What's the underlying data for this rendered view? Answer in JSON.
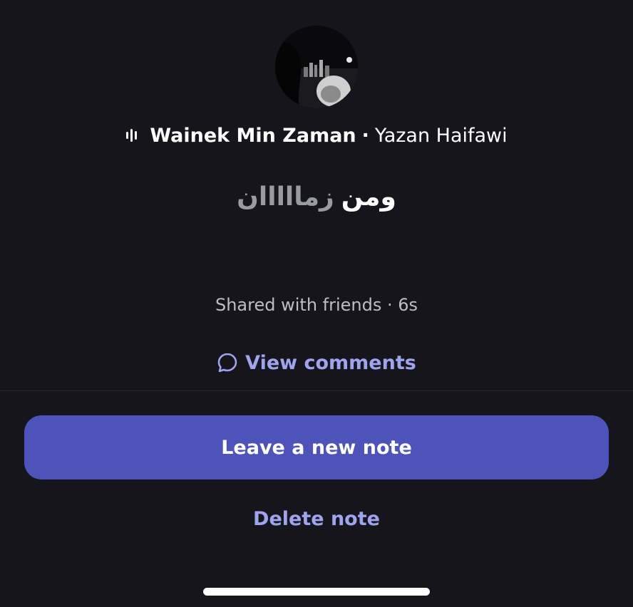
{
  "song": {
    "icon": "music-bars-icon",
    "title": "Wainek Min Zaman",
    "separator": "·",
    "artist": "Yazan Haifawi"
  },
  "note": {
    "word_bold": "ومن",
    "word_light": "زمااااان"
  },
  "meta": {
    "shared_text": "Shared with friends · 6s"
  },
  "comments": {
    "icon": "speech-bubble-icon",
    "label": "View comments"
  },
  "actions": {
    "leave_note_label": "Leave a new note",
    "delete_note_label": "Delete note"
  },
  "colors": {
    "background": "#15151b",
    "accent": "#4d53b8",
    "link": "#9ea5ee"
  }
}
